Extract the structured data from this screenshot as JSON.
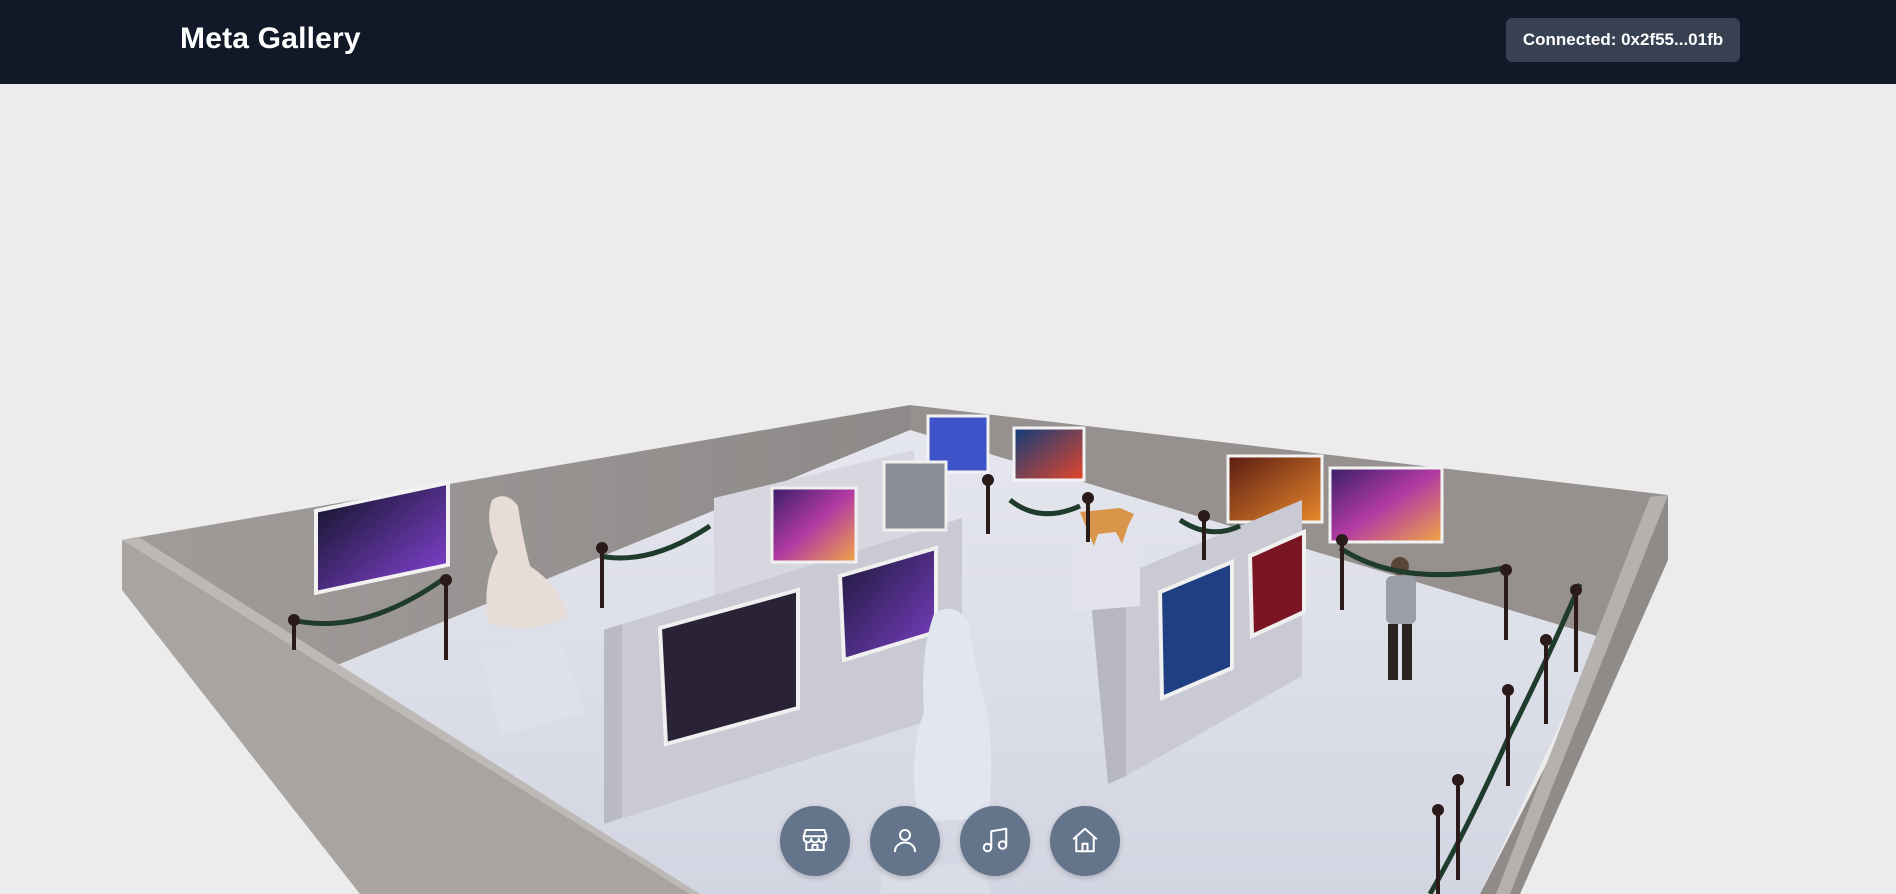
{
  "header": {
    "title": "Meta Gallery",
    "wallet_label": "Connected: 0x2f55...01fb"
  },
  "dock": {
    "buttons": [
      {
        "name": "store-button",
        "icon": "store-icon"
      },
      {
        "name": "avatar-button",
        "icon": "user-icon"
      },
      {
        "name": "music-button",
        "icon": "music-note-icon"
      },
      {
        "name": "home-button",
        "icon": "home-icon"
      }
    ]
  },
  "colors": {
    "topbar": "#111827",
    "wallet_bg": "#374151",
    "dock_bg": "#64748b",
    "scene_bg": "#ececec"
  }
}
